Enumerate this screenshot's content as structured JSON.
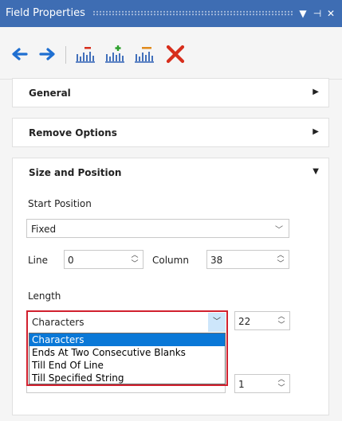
{
  "window": {
    "title": "Field Properties"
  },
  "titlebar_buttons": {
    "menu": "▼",
    "pin": "⊣",
    "close": "✕"
  },
  "sections": [
    {
      "label": "General",
      "expanded": false
    },
    {
      "label": "Remove Options",
      "expanded": false
    },
    {
      "label": "Size and Position",
      "expanded": true
    }
  ],
  "size_position": {
    "start_position_label": "Start Position",
    "start_position_value": "Fixed",
    "line_label": "Line",
    "line_value": "0",
    "column_label": "Column",
    "column_value": "38",
    "length_label": "Length",
    "length_value": "Characters",
    "length_number": "22",
    "second_number": "1",
    "length_options": [
      "Characters",
      "Ends At Two Consecutive Blanks",
      "Till End Of Line",
      "Till Specified String"
    ],
    "selected_option_index": 0
  },
  "colors": {
    "titlebar": "#3e6db3",
    "arrow_blue": "#1f6fd1",
    "delete_red": "#d72e1c",
    "highlight_border": "#d1202e",
    "selected_item": "#0a78d7"
  }
}
